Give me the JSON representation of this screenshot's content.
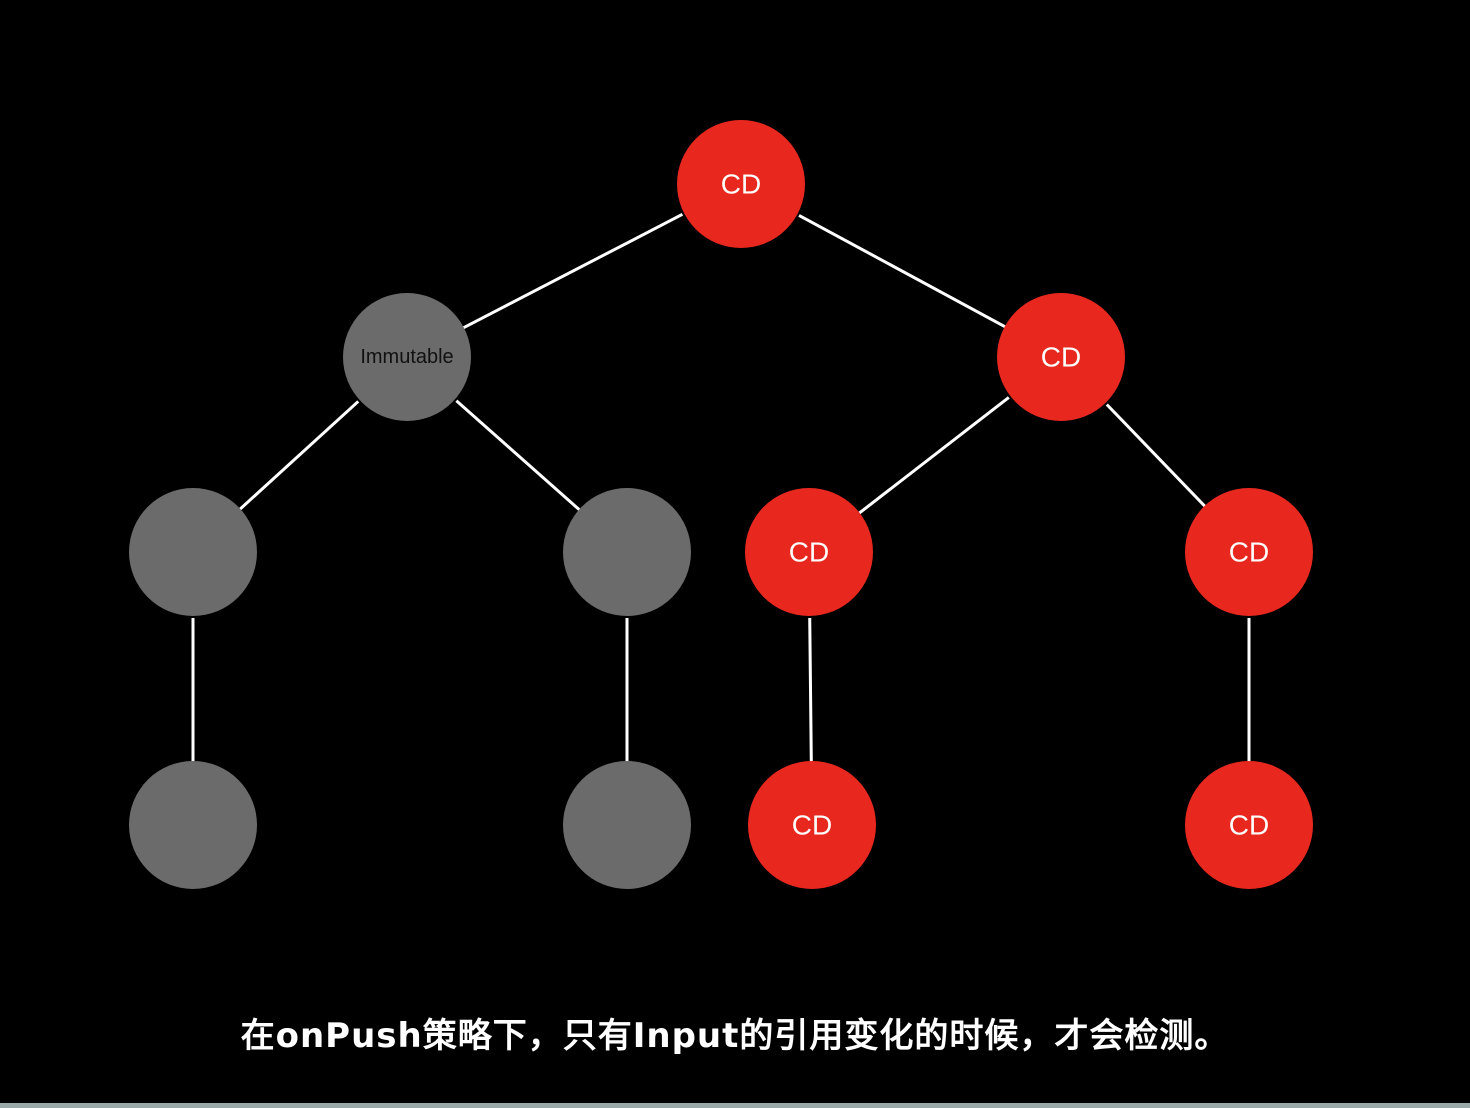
{
  "caption": "在onPush策略下，只有Input的引用变化的时候，才会检测。",
  "colors": {
    "checked": "#e8281f",
    "skipped": "#6b6b6b",
    "edge": "#ffffff"
  },
  "nodes": [
    {
      "id": "root",
      "label": "CD",
      "state": "checked"
    },
    {
      "id": "left",
      "label": "Immutable",
      "state": "skipped"
    },
    {
      "id": "right",
      "label": "CD",
      "state": "checked"
    },
    {
      "id": "left-left",
      "label": "",
      "state": "skipped"
    },
    {
      "id": "left-right",
      "label": "",
      "state": "skipped"
    },
    {
      "id": "right-left",
      "label": "CD",
      "state": "checked"
    },
    {
      "id": "right-right",
      "label": "CD",
      "state": "checked"
    },
    {
      "id": "left-left-child",
      "label": "",
      "state": "skipped"
    },
    {
      "id": "left-right-child",
      "label": "",
      "state": "skipped"
    },
    {
      "id": "right-left-child",
      "label": "CD",
      "state": "checked"
    },
    {
      "id": "right-right-child",
      "label": "CD",
      "state": "checked"
    }
  ],
  "edges": [
    [
      "root",
      "left"
    ],
    [
      "root",
      "right"
    ],
    [
      "left",
      "left-left"
    ],
    [
      "left",
      "left-right"
    ],
    [
      "right",
      "right-left"
    ],
    [
      "right",
      "right-right"
    ],
    [
      "left-left",
      "left-left-child"
    ],
    [
      "left-right",
      "left-right-child"
    ],
    [
      "right-left",
      "right-left-child"
    ],
    [
      "right-right",
      "right-right-child"
    ]
  ]
}
